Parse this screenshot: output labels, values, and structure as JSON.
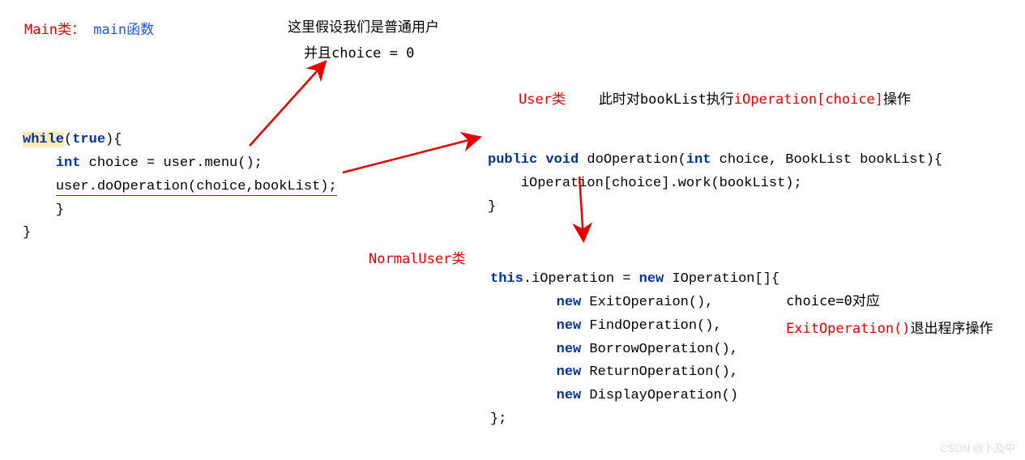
{
  "labels": {
    "main_class_red": "Main类：",
    "main_class_blue": "main函数",
    "assumption_line1": "这里假设我们是普通用户",
    "assumption_line2": "并且choice = 0",
    "user_class": "User类",
    "user_class_note_prefix": "此时对bookList执行",
    "user_class_note_red": "iOperation[choice]",
    "user_class_note_suffix": "操作",
    "normal_user_class": "NormalUser类",
    "choice_note_line1": "choice=0对应",
    "choice_note_red": "ExitOperation()",
    "choice_note_suffix": "退出程序操作",
    "watermark": "CSDN @卜及中"
  },
  "code": {
    "main": {
      "kw_while": "while",
      "cond": "true",
      "line1_kw_int": "int",
      "line1_rest": " choice = user.menu();",
      "line2": "user.doOperation(choice,bookList);",
      "close1": "}",
      "close2": "}"
    },
    "user": {
      "kw_public": "public",
      "kw_void": "void",
      "method": " doOperation(",
      "kw_int": "int",
      "param1": " choice, BookList bookList){",
      "body": "iOperation[choice].work(bookList);",
      "close": "}"
    },
    "normal": {
      "kw_this": "this",
      "line0_a": ".iOperation = ",
      "kw_new0": "new",
      "line0_b": " IOperation[]{",
      "kw_new1": "new",
      "item1": " ExitOperaion(),",
      "kw_new2": "new",
      "item2": " FindOperation(),",
      "kw_new3": "new",
      "item3": " BorrowOperation(),",
      "kw_new4": "new",
      "item4": " ReturnOperation(),",
      "kw_new5": "new",
      "item5": " DisplayOperation()",
      "close": "};"
    }
  }
}
